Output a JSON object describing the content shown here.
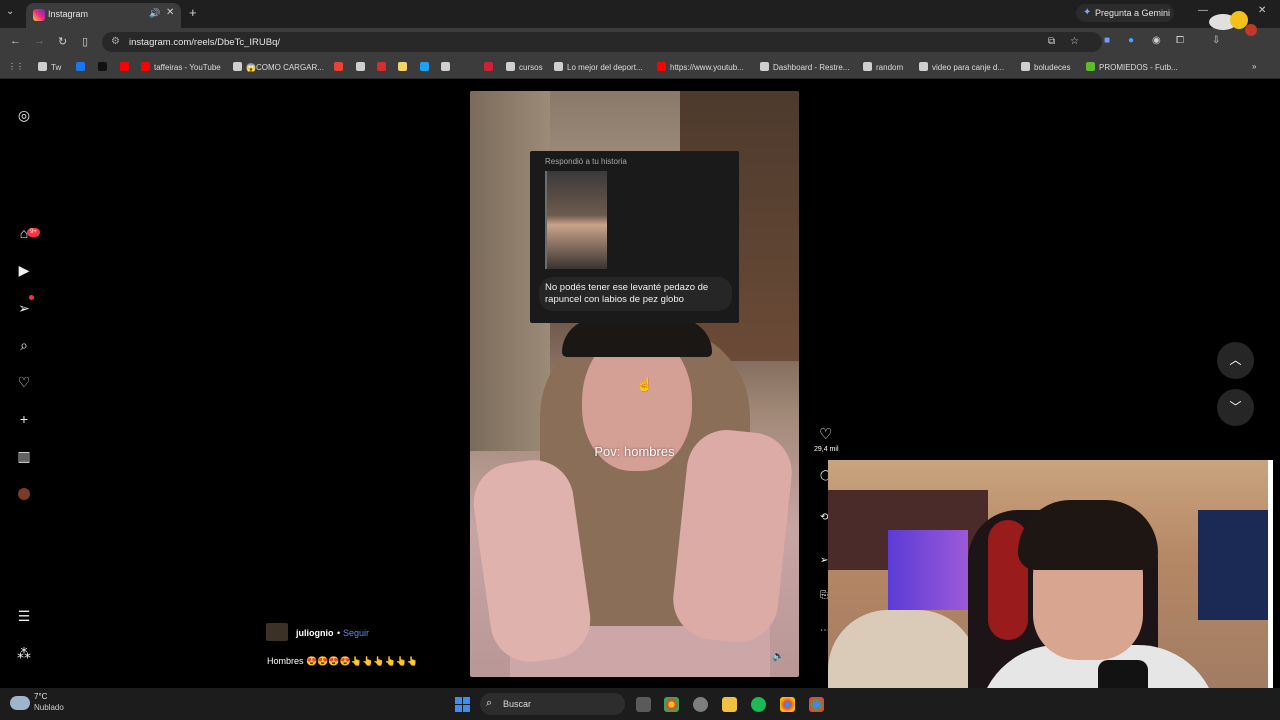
{
  "browser": {
    "tab_title": "Instagram",
    "gemini_label": "Pregunta a Gemini",
    "url": "instagram.com/reels/DbeTc_IRUBq/",
    "bookmarks": [
      {
        "label": "Tw",
        "color": "#cfcfcf"
      },
      {
        "label": "",
        "color": "#1877f2"
      },
      {
        "label": "",
        "color": "#111111"
      },
      {
        "label": "",
        "color": "#ff0000"
      },
      {
        "label": "taffeiras - YouTube",
        "color": "#ff0000"
      },
      {
        "label": "😱COMO CARGAR...",
        "color": "#cfcfcf"
      },
      {
        "label": "",
        "color": "#ea4335"
      },
      {
        "label": "",
        "color": "#cfcfcf"
      },
      {
        "label": "",
        "color": "#d62d2d"
      },
      {
        "label": "",
        "color": "#f3d36b"
      },
      {
        "label": "",
        "color": "#1da1f2"
      },
      {
        "label": "",
        "color": "#cfcfcf"
      },
      {
        "label": "",
        "color": "#cc2233"
      },
      {
        "label": "cursos",
        "color": "#cfcfcf"
      },
      {
        "label": "Lo mejor del deport...",
        "color": "#cfcfcf"
      },
      {
        "label": "https://www.youtub...",
        "color": "#ff0000"
      },
      {
        "label": "Dashboard - Restre...",
        "color": "#cfcfcf"
      },
      {
        "label": "random",
        "color": "#cfcfcf"
      },
      {
        "label": "video para canje d...",
        "color": "#cfcfcf"
      },
      {
        "label": "boludeces",
        "color": "#cfcfcf"
      },
      {
        "label": "PROMIEDOS - Futb...",
        "color": "#5bbd2b"
      }
    ]
  },
  "sidebar": {
    "notification_badge": "9+"
  },
  "reel": {
    "story_reply_header": "Respondió a tu historia",
    "story_reply_message": "No podés tener ese levanté pedazo de rapuncel con labios de pez globo",
    "overlay_text": "Pov: hombres",
    "likes": "29,4 mil",
    "username": "juliognio",
    "follow_label": "Seguir",
    "caption": "Hombres 😍😍😍😍👆👆👆👆👆👆"
  },
  "taskbar": {
    "temperature": "7°C",
    "condition": "Nublado",
    "search_placeholder": "Buscar"
  }
}
